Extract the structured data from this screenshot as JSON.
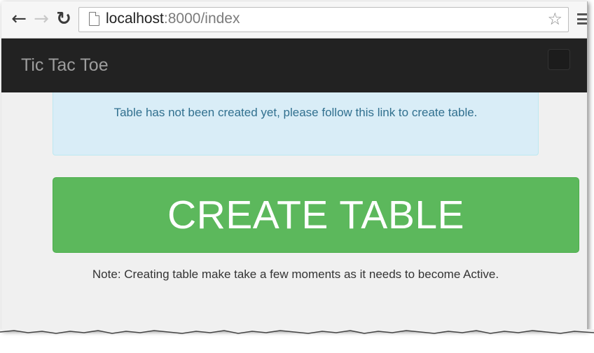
{
  "browser": {
    "url_host": "localhost",
    "url_rest": ":8000/index",
    "back_icon": "back-arrow-icon",
    "forward_icon": "forward-arrow-icon",
    "reload_icon": "reload-icon",
    "bookmark_icon": "star-icon",
    "menu_icon": "hamburger-menu-icon"
  },
  "navbar": {
    "brand": "Tic Tac Toe",
    "background": "#222222"
  },
  "alert": {
    "message": "Table has not been created yet, please follow this link to create table.",
    "color": "#31708f",
    "background": "#d9edf7"
  },
  "main": {
    "create_button_label": "CREATE TABLE",
    "button_color": "#5cb85c",
    "note": "Note: Creating table make take a few moments as it needs to become Active."
  }
}
